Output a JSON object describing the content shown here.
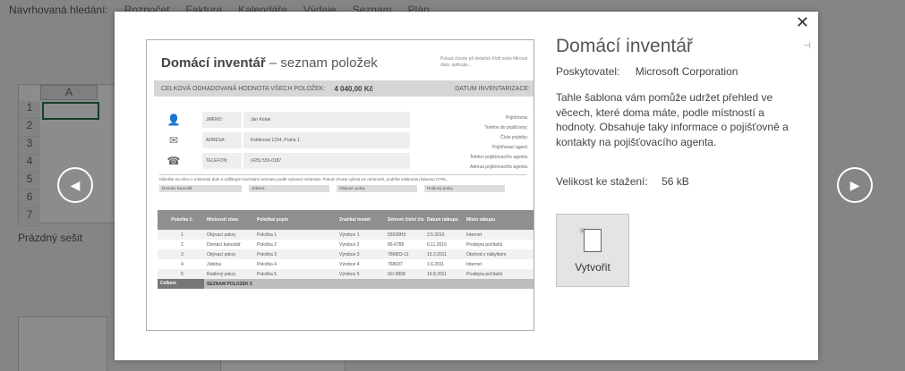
{
  "background": {
    "nav_lead": "Navrhovaná hledání:",
    "nav_items": [
      "Rozpočet",
      "Faktura",
      "Kalendáře",
      "Výdaje",
      "Seznam",
      "Plán"
    ],
    "column_header": "A",
    "row_numbers": [
      "1",
      "2",
      "3",
      "4",
      "5",
      "6",
      "7"
    ],
    "blank_workbook": "Prázdný sešit"
  },
  "preview": {
    "title_bold": "Domácí inventář",
    "title_rest": " – seznam položek",
    "note": "Pokud chcete při detailně třídit nebo filtrovat data, aplikujte...",
    "total_label": "CELKOVÁ ODHADOVANÁ HODNOTA VŠECH POLOŽEK:",
    "total_value": "4 040,00 Kč",
    "inventory_date_label": "DATUM INVENTARIZACE:",
    "contacts": [
      {
        "label": "JMÉNO:",
        "value": "Jan Kotak"
      },
      {
        "label": "ADRESA:",
        "value": "Květinová 1234, Praha 1"
      },
      {
        "label": "TELEFON:",
        "value": "(425) 555-0187"
      }
    ],
    "insurance_labels": [
      "Pojišťovna:",
      "Telefon do pojišťovny:",
      "Číslo pojistky:",
      "Pojišťovací agent:",
      "Telefon pojišťovacího agenta:",
      "Adresa pojišťovacího agenta:"
    ],
    "instructions": "Klikněte na něco z místností dole a odfiltrujte inventární seznam podle vybrané místnosti. Pokud chcete vybrat víc místností, podržte stisknutou klávesu CTRL.",
    "filters": [
      "Domácí kancelář",
      "Jídelna",
      "Obývací pokoj",
      "Rodinný pokoj"
    ],
    "table_headers": [
      "Položka č.",
      "Místnost/ zóna",
      "Položka/ popis",
      "Značka/ model",
      "Sériové číslo/ číslo ID",
      "Datum nákupu",
      "Místo nákupu"
    ],
    "rows": [
      [
        "1",
        "Obývací pokoj",
        "Položka 1",
        "Výrobce 1",
        "55928H3",
        "2.5.2010",
        "Internet"
      ],
      [
        "2",
        "Domácí kancelář",
        "Položka 2",
        "Výrobce 2",
        "66-6786",
        "6.11.2010",
        "Prodejna počítačů"
      ],
      [
        "3",
        "Obývací pokoj",
        "Položka 3",
        "Výrobce 3",
        "766833-11",
        "15.3.2011",
        "Obchod s nábytkem"
      ],
      [
        "4",
        "Jídelna",
        "Položka 4",
        "Výrobce 4",
        "768037",
        "1.6.2011",
        "Internet"
      ],
      [
        "5",
        "Rodinný pokoj",
        "Položka 5",
        "Výrobce 5",
        "SD-9898",
        "19.8.2011",
        "Prodejna počítačů"
      ]
    ],
    "total_row_label": "Celkem",
    "total_row_text": "SEZNAM POLOŽEK 5"
  },
  "details": {
    "title": "Domácí inventář",
    "provider_label": "Poskytovatel:",
    "provider_value": "Microsoft Corporation",
    "description": "Tahle šablona vám pomůže udržet přehled ve věcech, které doma máte, podle místností a hodnoty. Obsahuje taky informace o pojišťovně a kontakty na pojišťovacího agenta.",
    "size_label": "Velikost ke stažení:",
    "size_value": "56 kB",
    "create_label": "Vytvořit"
  },
  "icons": {
    "close": "close-icon",
    "pin": "pin-icon",
    "prev": "chevron-left-icon",
    "next": "chevron-right-icon"
  }
}
